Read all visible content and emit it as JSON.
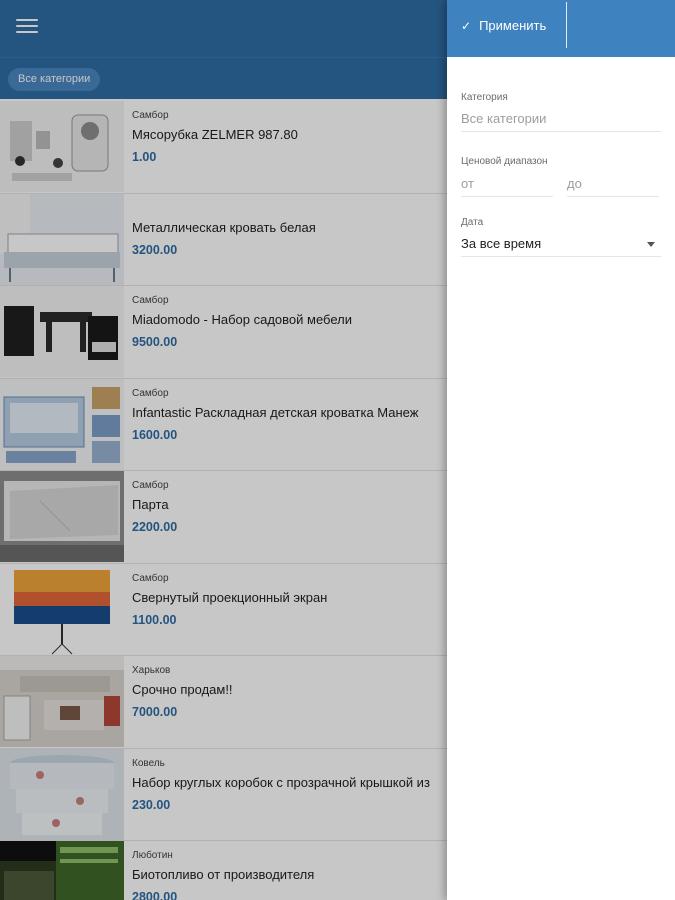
{
  "appbar": {
    "menu_icon": "hamburger-menu-icon",
    "color": "#2f6ca5"
  },
  "category_chip": {
    "label": "Все категории"
  },
  "listings": [
    {
      "city": "Самбор",
      "title": "Мясорубка ZELMER 987.80",
      "price": "1.00"
    },
    {
      "city": "",
      "title": "Металлическая кровать белая",
      "price": "3200.00"
    },
    {
      "city": "Самбор",
      "title": "Miadomodo - Набор садовой мебели",
      "price": "9500.00"
    },
    {
      "city": "Самбор",
      "title": "Infantastic Раскладная детская кроватка Манеж",
      "price": "1600.00"
    },
    {
      "city": "Самбор",
      "title": "Парта",
      "price": "2200.00"
    },
    {
      "city": "Самбор",
      "title": "Свернутый проекционный экран",
      "price": "1100.00"
    },
    {
      "city": "Харьков",
      "title": "Срочно продам!!",
      "price": "7000.00"
    },
    {
      "city": "Ковель",
      "title": "Набор круглых коробок с прозрачной крышкой из",
      "price": "230.00"
    },
    {
      "city": "Люботин",
      "title": "Биотопливо от производителя",
      "price": "2800.00"
    }
  ],
  "filter": {
    "apply_label": "Применить",
    "apply_icon": "check-icon",
    "category_label": "Категория",
    "category_placeholder": "Все категории",
    "price_label": "Ценовой диапазон",
    "price_from_placeholder": "от",
    "price_to_placeholder": "до",
    "date_label": "Дата",
    "date_value": "За все время",
    "dropdown_icon": "dropdown-arrow-icon",
    "accent_color": "#3f82c0"
  }
}
